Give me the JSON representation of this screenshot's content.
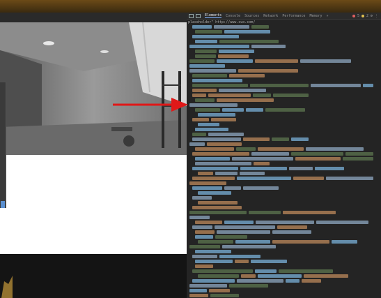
{
  "devtools": {
    "tabs": [
      {
        "label": "Elements",
        "active": true
      },
      {
        "label": "Console",
        "active": false
      },
      {
        "label": "Sources",
        "active": false
      },
      {
        "label": "Network",
        "active": false
      },
      {
        "label": "Performance",
        "active": false
      },
      {
        "label": "Memory",
        "active": false
      },
      {
        "label": "»",
        "active": false
      }
    ],
    "error_count": "5",
    "warning_count": "2",
    "breadcrumb": "placeholder\" http://www.cuo.com/",
    "accent_color": "#7fb3ff"
  },
  "annotation": {
    "arrow_color": "#e01818",
    "icon": "arrow-right-icon"
  },
  "page": {
    "photo_description_icon": "gym-room-photo",
    "side_button_color": "#5a8fd0"
  }
}
